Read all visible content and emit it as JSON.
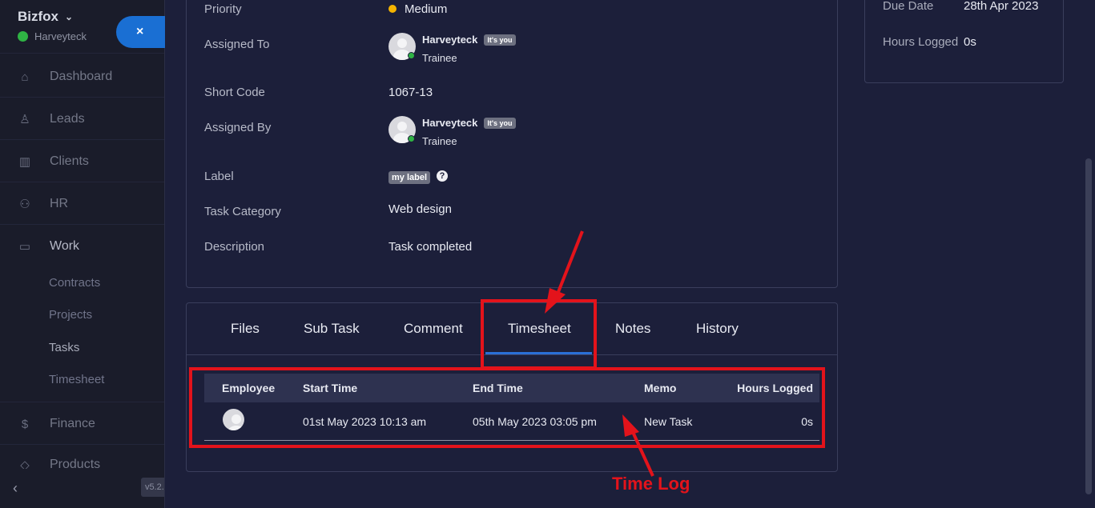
{
  "sidebar": {
    "brand": "Bizfox",
    "user_status": "Harveyteck",
    "close_symbol": "×",
    "nav": [
      {
        "label": "Dashboard",
        "icon": "home-icon",
        "glyph": "⌂"
      },
      {
        "label": "Leads",
        "icon": "person-icon",
        "glyph": "♙"
      },
      {
        "label": "Clients",
        "icon": "building-icon",
        "glyph": "▥"
      },
      {
        "label": "HR",
        "icon": "people-icon",
        "glyph": "⚇"
      },
      {
        "label": "Work",
        "icon": "briefcase-icon",
        "glyph": "▭"
      },
      {
        "label": "Finance",
        "icon": "dollar-icon",
        "glyph": "$"
      },
      {
        "label": "Products",
        "icon": "cube-icon",
        "glyph": "◇"
      }
    ],
    "work_sub": [
      "Contracts",
      "Projects",
      "Tasks",
      "Timesheet"
    ],
    "collapse_symbol": "‹",
    "version": "v5.2."
  },
  "task": {
    "priority_label": "Priority",
    "priority_value": "Medium",
    "assigned_to_label": "Assigned To",
    "assigned_to": {
      "name": "Harveyteck",
      "badge": "It's you",
      "role": "Trainee"
    },
    "short_code_label": "Short Code",
    "short_code": "1067-13",
    "assigned_by_label": "Assigned By",
    "assigned_by": {
      "name": "Harveyteck",
      "badge": "It's you",
      "role": "Trainee"
    },
    "label_label": "Label",
    "label_value": "my label",
    "help_symbol": "?",
    "category_label": "Task Category",
    "category_value": "Web design",
    "description_label": "Description",
    "description_value": "Task completed"
  },
  "side": {
    "due_date_label": "Due Date",
    "due_date": "28th Apr 2023",
    "hours_logged_label": "Hours Logged",
    "hours_logged": "0s"
  },
  "tabs": [
    "Files",
    "Sub Task",
    "Comment",
    "Timesheet",
    "Notes",
    "History"
  ],
  "active_tab": "Timesheet",
  "timesheet": {
    "columns": [
      "Employee",
      "Start Time",
      "End Time",
      "Memo",
      "Hours Logged"
    ],
    "rows": [
      {
        "start": "01st May 2023 10:13 am",
        "end": "05th May 2023 03:05 pm",
        "memo": "New Task",
        "hours": "0s"
      }
    ]
  },
  "annotation": {
    "label": "Time Log",
    "color": "#e3131b"
  },
  "colors": {
    "accent": "#2a6fd6",
    "online": "#2fb344",
    "priority_medium": "#f5b400"
  }
}
